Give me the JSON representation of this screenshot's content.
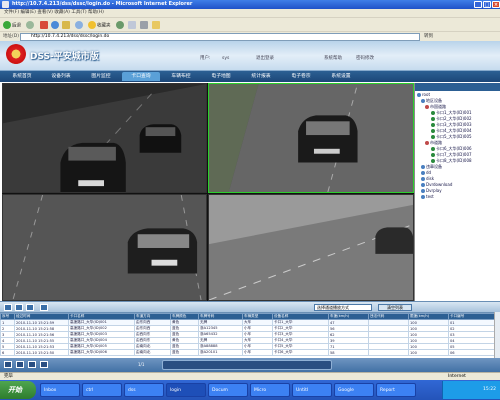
{
  "window": {
    "title": "http://10.7.4.213/dss/dssc/login.do - Microsoft Internet Explorer"
  },
  "menu": {
    "text": "文件(F)  编辑(E)  查看(V)  收藏(A)  工具(T)  帮助(H)"
  },
  "toolbar": {
    "back": "后退",
    "favorites": "收藏夹"
  },
  "address": {
    "label": "地址(D)",
    "value": "http://10.7.4.213/dss/dssc/login.do",
    "go": "转到"
  },
  "app": {
    "title": "DSS-平安城市版"
  },
  "header": {
    "user_label": "用户:",
    "user_value": "sys",
    "logout": "退出登录",
    "help": "系统帮助",
    "password": "密码修改"
  },
  "nav": {
    "tabs": [
      "系统首页",
      "设备列表",
      "图片监控",
      "卡口查询",
      "车辆布控",
      "电子地图",
      "统计报表",
      "电子卷宗",
      "系统设置"
    ],
    "active": 3
  },
  "tree": {
    "items": [
      "root",
      "地区设备",
      "市国道路",
      "卡口1_大华(ID)001",
      "卡口2_大华(ID)002",
      "卡口3_大华(ID)003",
      "卡口4_大华(ID)004",
      "卡口5_大华(ID)005",
      "市道路",
      "卡口6_大华(ID)006",
      "卡口7_大华(ID)007",
      "卡口8_大华(ID)008",
      "违章设备",
      "dd",
      "disk",
      "Dvrdownload",
      "Dvrplay",
      "test"
    ]
  },
  "controls": {
    "select_value": "选择通道播放方式",
    "clear": "清空列表"
  },
  "table": {
    "headers": [
      "序号",
      "经过时间",
      "卡口名称",
      "车道方向",
      "车牌颜色",
      "车牌号码",
      "车辆类型",
      "设备名称",
      "车速(km/h)",
      "违法代码",
      "限速(km/h)",
      "卡口编号"
    ],
    "rows": [
      [
        "1",
        "2010-11-10 15:21:59",
        "高速路口_大华(ID)001",
        "由东向西",
        "黄色",
        "无牌",
        "大车",
        "卡口1_大华",
        "47",
        "",
        "100",
        "01"
      ],
      [
        "2",
        "2010-11-10 15:21:58",
        "高速路口_大华(ID)002",
        "由东向西",
        "蓝色",
        "浙A12345",
        "小车",
        "卡口2_大华",
        "56",
        "",
        "100",
        "02"
      ],
      [
        "3",
        "2010-11-10 15:21:56",
        "高速路口_大华(ID)003",
        "由西向东",
        "蓝色",
        "浙A65432",
        "小车",
        "卡口3_大华",
        "62",
        "",
        "100",
        "03"
      ],
      [
        "4",
        "2010-11-10 15:21:55",
        "高速路口_大华(ID)004",
        "由西向东",
        "黄色",
        "无牌",
        "大车",
        "卡口4_大华",
        "39",
        "",
        "100",
        "04"
      ],
      [
        "5",
        "2010-11-10 15:21:53",
        "高速路口_大华(ID)005",
        "由南向北",
        "蓝色",
        "浙A88888",
        "小车",
        "卡口5_大华",
        "71",
        "",
        "100",
        "05"
      ],
      [
        "6",
        "2010-11-10 15:21:50",
        "高速路口_大华(ID)006",
        "由南向北",
        "蓝色",
        "浙A20101",
        "小车",
        "卡口6_大华",
        "58",
        "",
        "100",
        "06"
      ]
    ]
  },
  "bottom": {
    "page": "1/1"
  },
  "status": {
    "left": "完毕",
    "right": "Internet"
  },
  "taskbar": {
    "start": "开始",
    "tasks": [
      "Inbox",
      "ctrl",
      "dss",
      "login",
      "Docum",
      "Micro",
      "Untitl",
      "Google",
      "Report"
    ],
    "clock": "15:22"
  },
  "colors": {
    "title_blue": "#1f52c8",
    "nav_blue": "#1c4778",
    "active_tab": "#5aa0d8",
    "selected_cam": "#2cd02c"
  }
}
